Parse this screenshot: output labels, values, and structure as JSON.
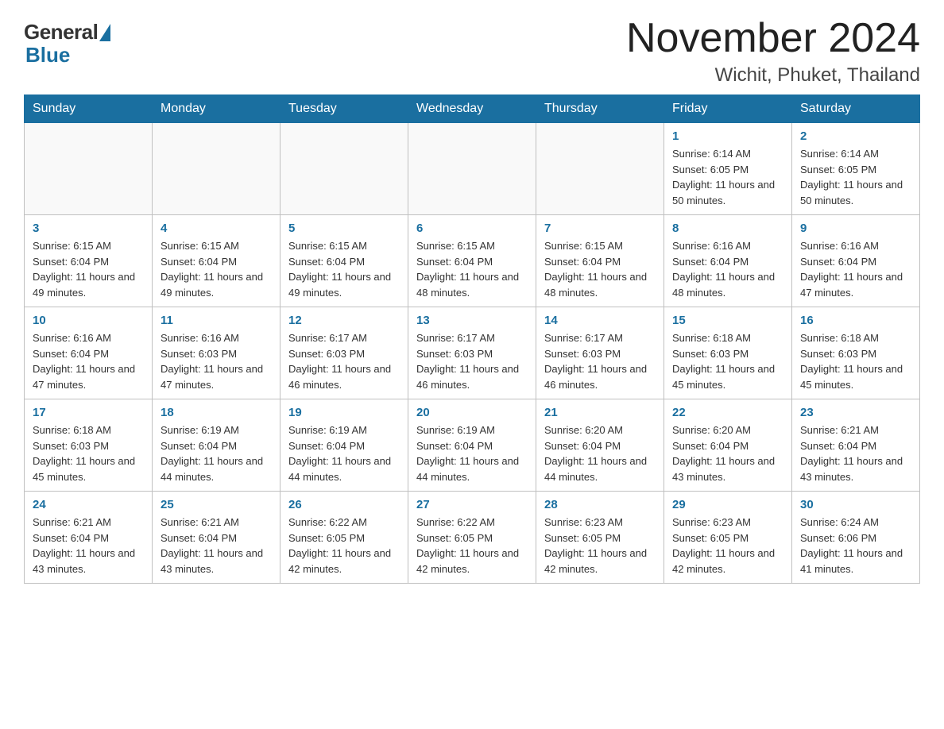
{
  "logo": {
    "general": "General",
    "blue": "Blue"
  },
  "header": {
    "month": "November 2024",
    "location": "Wichit, Phuket, Thailand"
  },
  "weekdays": [
    "Sunday",
    "Monday",
    "Tuesday",
    "Wednesday",
    "Thursday",
    "Friday",
    "Saturday"
  ],
  "weeks": [
    [
      {
        "day": "",
        "info": ""
      },
      {
        "day": "",
        "info": ""
      },
      {
        "day": "",
        "info": ""
      },
      {
        "day": "",
        "info": ""
      },
      {
        "day": "",
        "info": ""
      },
      {
        "day": "1",
        "info": "Sunrise: 6:14 AM\nSunset: 6:05 PM\nDaylight: 11 hours and 50 minutes."
      },
      {
        "day": "2",
        "info": "Sunrise: 6:14 AM\nSunset: 6:05 PM\nDaylight: 11 hours and 50 minutes."
      }
    ],
    [
      {
        "day": "3",
        "info": "Sunrise: 6:15 AM\nSunset: 6:04 PM\nDaylight: 11 hours and 49 minutes."
      },
      {
        "day": "4",
        "info": "Sunrise: 6:15 AM\nSunset: 6:04 PM\nDaylight: 11 hours and 49 minutes."
      },
      {
        "day": "5",
        "info": "Sunrise: 6:15 AM\nSunset: 6:04 PM\nDaylight: 11 hours and 49 minutes."
      },
      {
        "day": "6",
        "info": "Sunrise: 6:15 AM\nSunset: 6:04 PM\nDaylight: 11 hours and 48 minutes."
      },
      {
        "day": "7",
        "info": "Sunrise: 6:15 AM\nSunset: 6:04 PM\nDaylight: 11 hours and 48 minutes."
      },
      {
        "day": "8",
        "info": "Sunrise: 6:16 AM\nSunset: 6:04 PM\nDaylight: 11 hours and 48 minutes."
      },
      {
        "day": "9",
        "info": "Sunrise: 6:16 AM\nSunset: 6:04 PM\nDaylight: 11 hours and 47 minutes."
      }
    ],
    [
      {
        "day": "10",
        "info": "Sunrise: 6:16 AM\nSunset: 6:04 PM\nDaylight: 11 hours and 47 minutes."
      },
      {
        "day": "11",
        "info": "Sunrise: 6:16 AM\nSunset: 6:03 PM\nDaylight: 11 hours and 47 minutes."
      },
      {
        "day": "12",
        "info": "Sunrise: 6:17 AM\nSunset: 6:03 PM\nDaylight: 11 hours and 46 minutes."
      },
      {
        "day": "13",
        "info": "Sunrise: 6:17 AM\nSunset: 6:03 PM\nDaylight: 11 hours and 46 minutes."
      },
      {
        "day": "14",
        "info": "Sunrise: 6:17 AM\nSunset: 6:03 PM\nDaylight: 11 hours and 46 minutes."
      },
      {
        "day": "15",
        "info": "Sunrise: 6:18 AM\nSunset: 6:03 PM\nDaylight: 11 hours and 45 minutes."
      },
      {
        "day": "16",
        "info": "Sunrise: 6:18 AM\nSunset: 6:03 PM\nDaylight: 11 hours and 45 minutes."
      }
    ],
    [
      {
        "day": "17",
        "info": "Sunrise: 6:18 AM\nSunset: 6:03 PM\nDaylight: 11 hours and 45 minutes."
      },
      {
        "day": "18",
        "info": "Sunrise: 6:19 AM\nSunset: 6:04 PM\nDaylight: 11 hours and 44 minutes."
      },
      {
        "day": "19",
        "info": "Sunrise: 6:19 AM\nSunset: 6:04 PM\nDaylight: 11 hours and 44 minutes."
      },
      {
        "day": "20",
        "info": "Sunrise: 6:19 AM\nSunset: 6:04 PM\nDaylight: 11 hours and 44 minutes."
      },
      {
        "day": "21",
        "info": "Sunrise: 6:20 AM\nSunset: 6:04 PM\nDaylight: 11 hours and 44 minutes."
      },
      {
        "day": "22",
        "info": "Sunrise: 6:20 AM\nSunset: 6:04 PM\nDaylight: 11 hours and 43 minutes."
      },
      {
        "day": "23",
        "info": "Sunrise: 6:21 AM\nSunset: 6:04 PM\nDaylight: 11 hours and 43 minutes."
      }
    ],
    [
      {
        "day": "24",
        "info": "Sunrise: 6:21 AM\nSunset: 6:04 PM\nDaylight: 11 hours and 43 minutes."
      },
      {
        "day": "25",
        "info": "Sunrise: 6:21 AM\nSunset: 6:04 PM\nDaylight: 11 hours and 43 minutes."
      },
      {
        "day": "26",
        "info": "Sunrise: 6:22 AM\nSunset: 6:05 PM\nDaylight: 11 hours and 42 minutes."
      },
      {
        "day": "27",
        "info": "Sunrise: 6:22 AM\nSunset: 6:05 PM\nDaylight: 11 hours and 42 minutes."
      },
      {
        "day": "28",
        "info": "Sunrise: 6:23 AM\nSunset: 6:05 PM\nDaylight: 11 hours and 42 minutes."
      },
      {
        "day": "29",
        "info": "Sunrise: 6:23 AM\nSunset: 6:05 PM\nDaylight: 11 hours and 42 minutes."
      },
      {
        "day": "30",
        "info": "Sunrise: 6:24 AM\nSunset: 6:06 PM\nDaylight: 11 hours and 41 minutes."
      }
    ]
  ]
}
